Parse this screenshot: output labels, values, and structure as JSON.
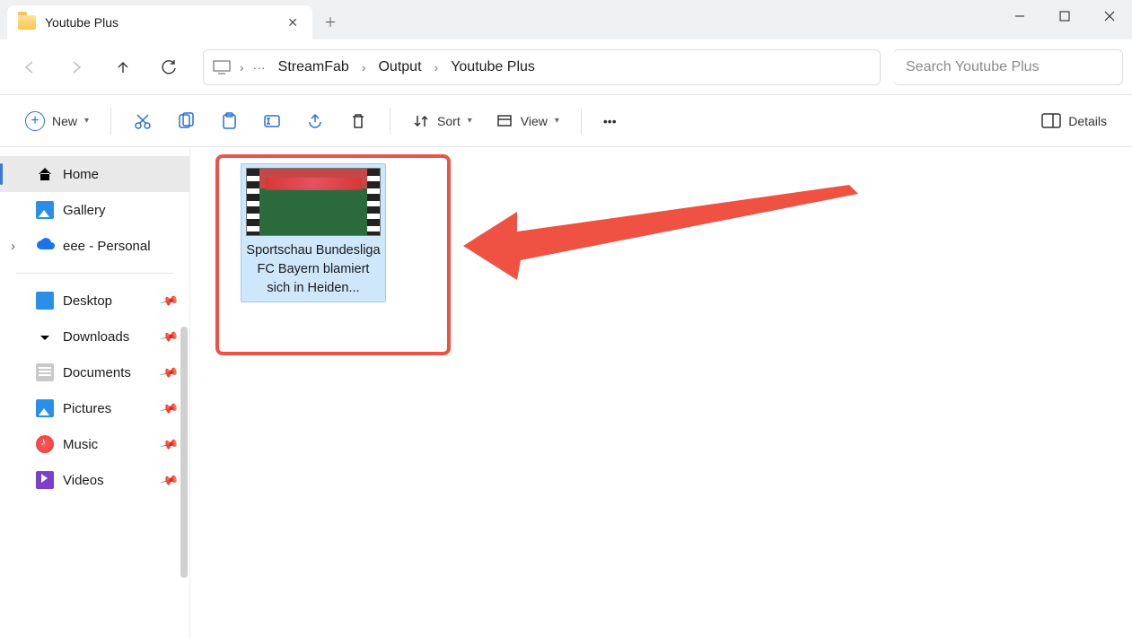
{
  "tab": {
    "title": "Youtube Plus"
  },
  "breadcrumbs": [
    "StreamFab",
    "Output",
    "Youtube Plus"
  ],
  "search": {
    "placeholder": "Search Youtube Plus"
  },
  "toolbar": {
    "new": "New",
    "sort": "Sort",
    "view": "View",
    "details": "Details"
  },
  "sidebar": {
    "home": "Home",
    "gallery": "Gallery",
    "onedrive": "eee - Personal",
    "desktop": "Desktop",
    "downloads": "Downloads",
    "documents": "Documents",
    "pictures": "Pictures",
    "music": "Music",
    "videos": "Videos"
  },
  "file": {
    "name": "Sportschau Bundesliga  FC Bayern blamiert sich in Heiden..."
  },
  "annotation": {
    "highlight_color": "#ef5243"
  }
}
